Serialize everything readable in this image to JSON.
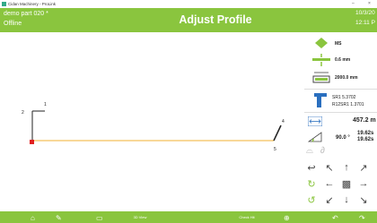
{
  "window": {
    "title": "Cidan Machinery - ProLink",
    "minimize_glyph": "–",
    "close_glyph": "×"
  },
  "header": {
    "part_name": "demo part 020 *",
    "status": "Offline",
    "title": "Adjust Profile",
    "date": "10/3/20",
    "time": "12:11 P"
  },
  "drawing": {
    "labels": [
      "1",
      "2",
      "4",
      "5"
    ]
  },
  "panel": {
    "material": "MS",
    "thickness": "0.6 mm",
    "width": "2000.0 mm",
    "tool_line1": "SR1 5.3702",
    "tool_line2": "R12SR1 1.3701",
    "length": "457.2 m",
    "angle": "90.0 °",
    "angle_value1": "19.62s",
    "angle_value2": "19.62s"
  },
  "bottom": {
    "view_label": "3D View",
    "check_label": "Check Hit"
  },
  "colors": {
    "header_green": "#8ac53e",
    "profile_line": "#f0b030",
    "accent_blue": "#2a6fbf",
    "marker_red": "#e02020"
  },
  "icons": [
    "app-icon",
    "diamond-icon",
    "thickness-icon",
    "width-icon",
    "tool-icon",
    "length-icon",
    "angle-icon",
    "arrow-icons"
  ]
}
